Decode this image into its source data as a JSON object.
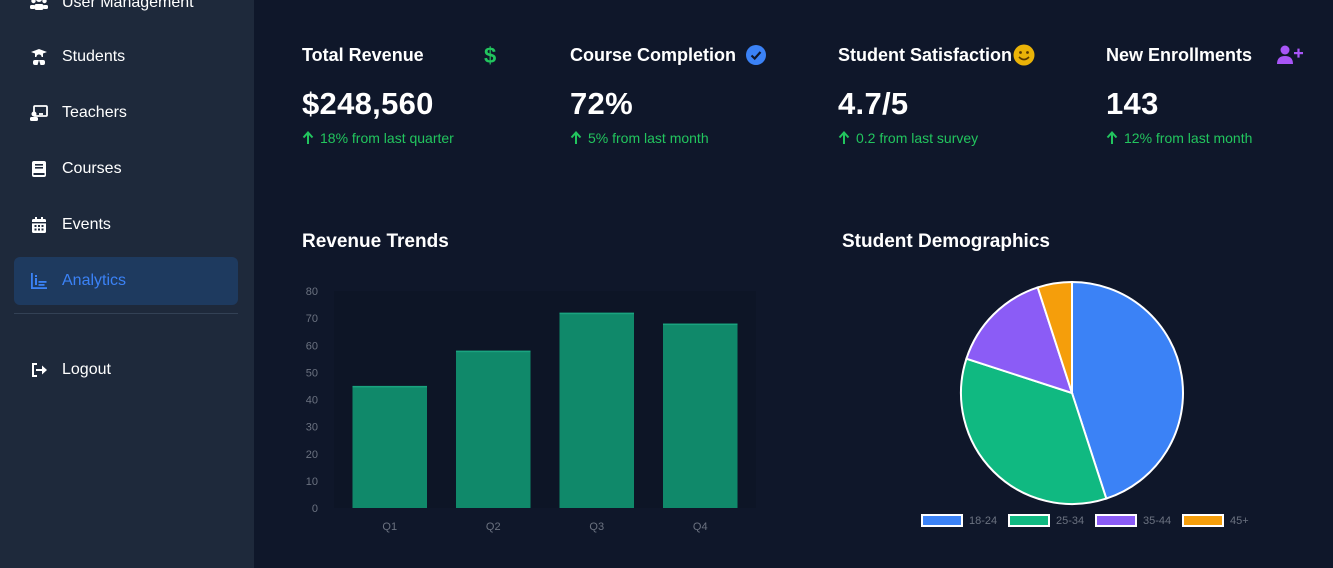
{
  "sidebar": {
    "items": [
      {
        "label": "User Management",
        "icon": "users-icon"
      },
      {
        "label": "Students",
        "icon": "graduate-icon"
      },
      {
        "label": "Teachers",
        "icon": "teacher-icon"
      },
      {
        "label": "Courses",
        "icon": "book-icon"
      },
      {
        "label": "Events",
        "icon": "calendar-icon"
      },
      {
        "label": "Analytics",
        "icon": "chart-icon",
        "active": true
      }
    ],
    "logout_label": "Logout"
  },
  "stats": [
    {
      "title": "Total Revenue",
      "icon": "dollar-icon",
      "icon_color": "#22c55e",
      "value": "$248,560",
      "change": "18% from last quarter"
    },
    {
      "title": "Course Completion",
      "icon": "check-badge-icon",
      "icon_color": "#3b82f6",
      "value": "72%",
      "change": "5% from last month"
    },
    {
      "title": "Student Satisfaction",
      "icon": "smile-icon",
      "icon_color": "#eab308",
      "value": "4.7/5",
      "change": "0.2 from last survey"
    },
    {
      "title": "New Enrollments",
      "icon": "user-plus-icon",
      "icon_color": "#a855f7",
      "value": "143",
      "change": "12% from last month"
    }
  ],
  "colors": {
    "accent": "#3b82f6",
    "positive": "#22c55e",
    "bar": "#10896a",
    "sidebar_bg": "#1e293b",
    "page_bg": "#0f172a"
  },
  "revenue_chart": {
    "title": "Revenue Trends",
    "chart_data": {
      "type": "bar",
      "categories": [
        "Q1",
        "Q2",
        "Q3",
        "Q4"
      ],
      "values": [
        45,
        58,
        72,
        68
      ],
      "ylim": [
        0,
        80
      ],
      "yticks": [
        0,
        10,
        20,
        30,
        40,
        50,
        60,
        70,
        80
      ],
      "grid": false,
      "color": "#10896a"
    }
  },
  "demographics_chart": {
    "title": "Student Demographics",
    "chart_data": {
      "type": "pie",
      "labels": [
        "18-24",
        "25-34",
        "35-44",
        "45+"
      ],
      "values": [
        45,
        35,
        15,
        5
      ],
      "colors": [
        "#3b82f6",
        "#10b981",
        "#8b5cf6",
        "#f59e0b"
      ],
      "legend": "bottom"
    }
  }
}
